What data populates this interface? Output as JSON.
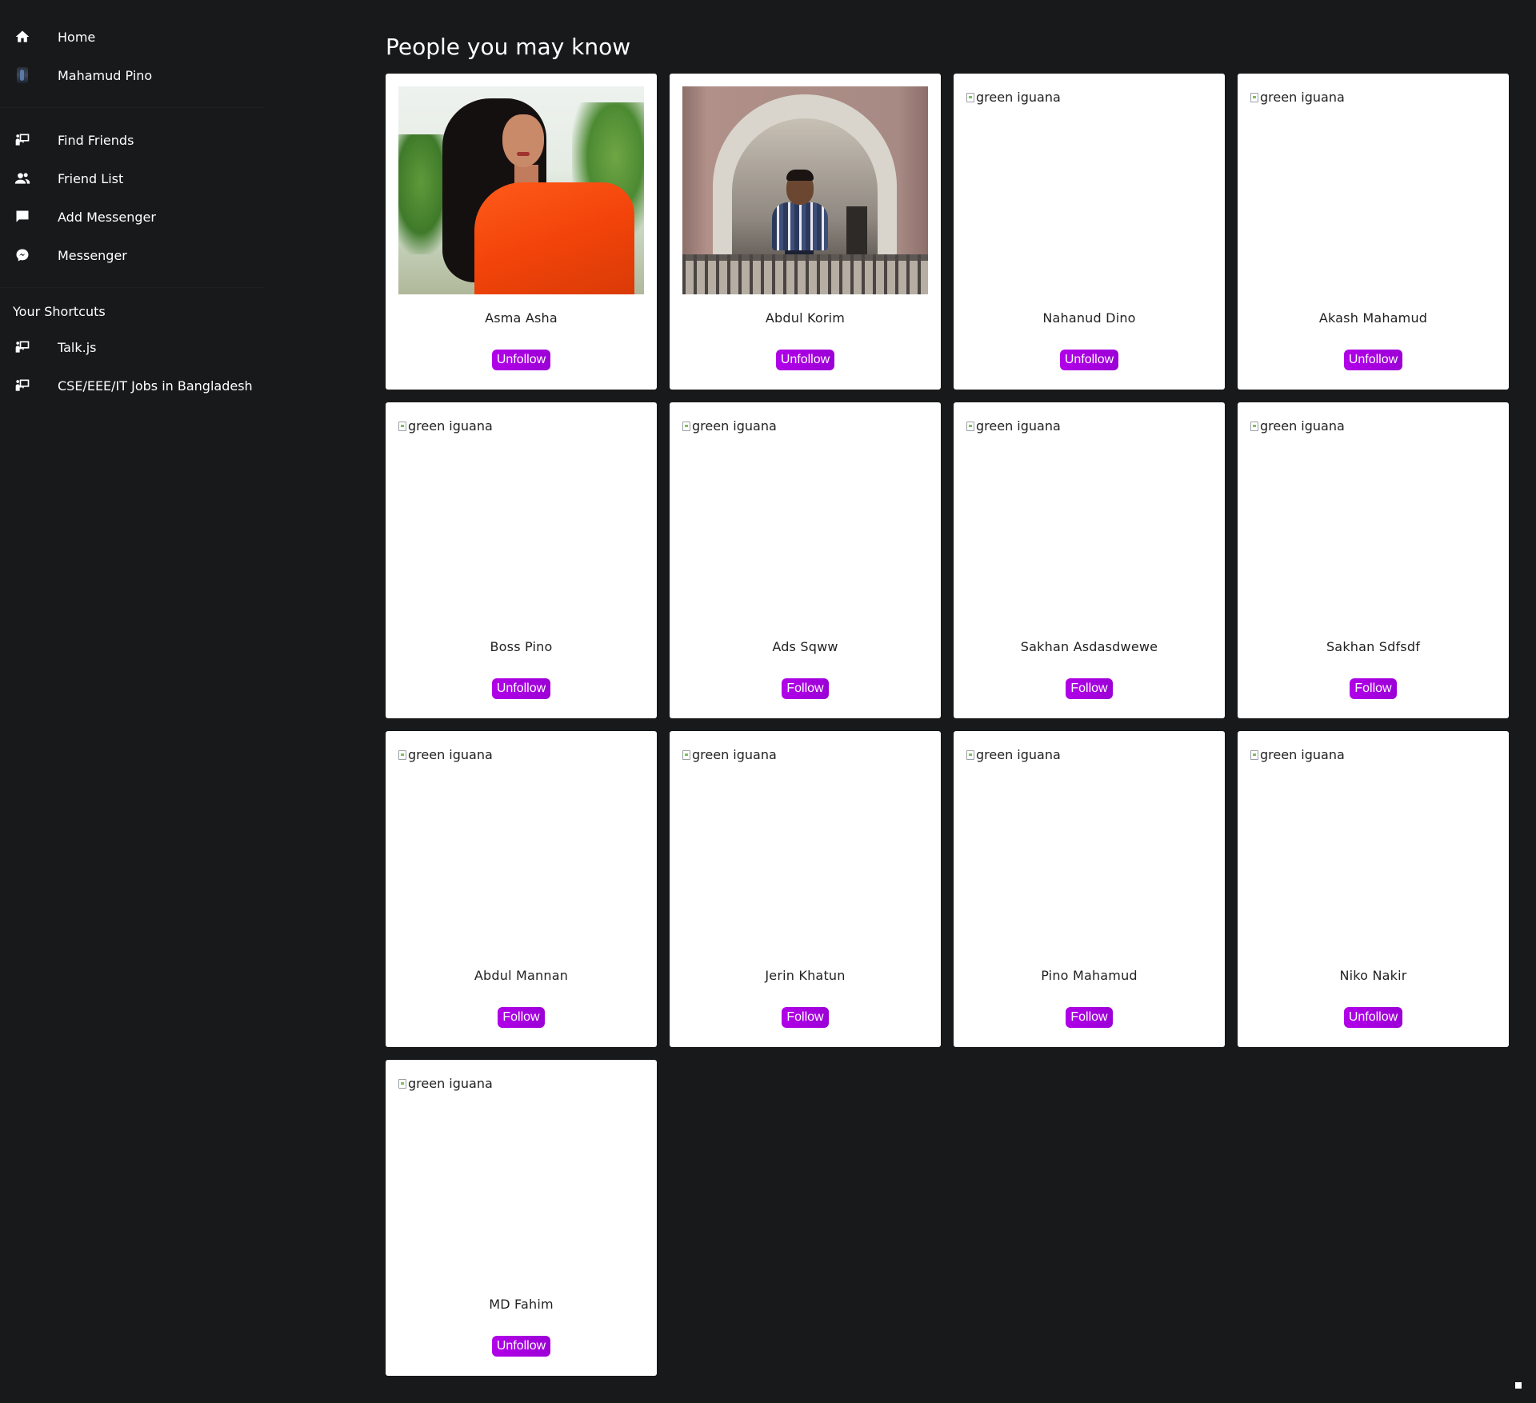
{
  "sidebar": {
    "top_items": [
      {
        "label": "Home",
        "icon": "home-icon"
      },
      {
        "label": "Mahamud Pino",
        "icon": "avatar"
      }
    ],
    "main_items": [
      {
        "label": "Find Friends",
        "icon": "find-friends-icon"
      },
      {
        "label": "Friend List",
        "icon": "people-icon"
      },
      {
        "label": "Add Messenger",
        "icon": "chat-bubble-icon"
      },
      {
        "label": "Messenger",
        "icon": "messenger-icon"
      }
    ],
    "shortcuts_title": "Your Shortcuts",
    "shortcuts": [
      {
        "label": "Talk.js",
        "icon": "find-friends-icon"
      },
      {
        "label": "CSE/EEE/IT Jobs in Bangladesh",
        "icon": "find-friends-icon"
      }
    ]
  },
  "main": {
    "title": "People you may know",
    "image_alt": "green iguana",
    "people": [
      {
        "name": "Asma Asha",
        "button": "Unfollow",
        "photo": "woman-photo"
      },
      {
        "name": "Abdul Korim",
        "button": "Unfollow",
        "photo": "man-photo"
      },
      {
        "name": "Nahanud Dino",
        "button": "Unfollow",
        "photo": "broken"
      },
      {
        "name": "Akash Mahamud",
        "button": "Unfollow",
        "photo": "broken"
      },
      {
        "name": "Boss Pino",
        "button": "Unfollow",
        "photo": "broken"
      },
      {
        "name": "Ads Sqww",
        "button": "Follow",
        "photo": "broken"
      },
      {
        "name": "Sakhan Asdasdwewe",
        "button": "Follow",
        "photo": "broken"
      },
      {
        "name": "Sakhan Sdfsdf",
        "button": "Follow",
        "photo": "broken"
      },
      {
        "name": "Abdul Mannan",
        "button": "Follow",
        "photo": "broken"
      },
      {
        "name": "Jerin Khatun",
        "button": "Follow",
        "photo": "broken"
      },
      {
        "name": "Pino Mahamud",
        "button": "Follow",
        "photo": "broken"
      },
      {
        "name": "Niko Nakir",
        "button": "Unfollow",
        "photo": "broken"
      },
      {
        "name": "MD Fahim",
        "button": "Unfollow",
        "photo": "broken"
      }
    ]
  },
  "colors": {
    "background": "#18191a",
    "card": "#ffffff",
    "button": "#a800e0",
    "text_light": "#ffffff",
    "text_dark": "#222222"
  }
}
